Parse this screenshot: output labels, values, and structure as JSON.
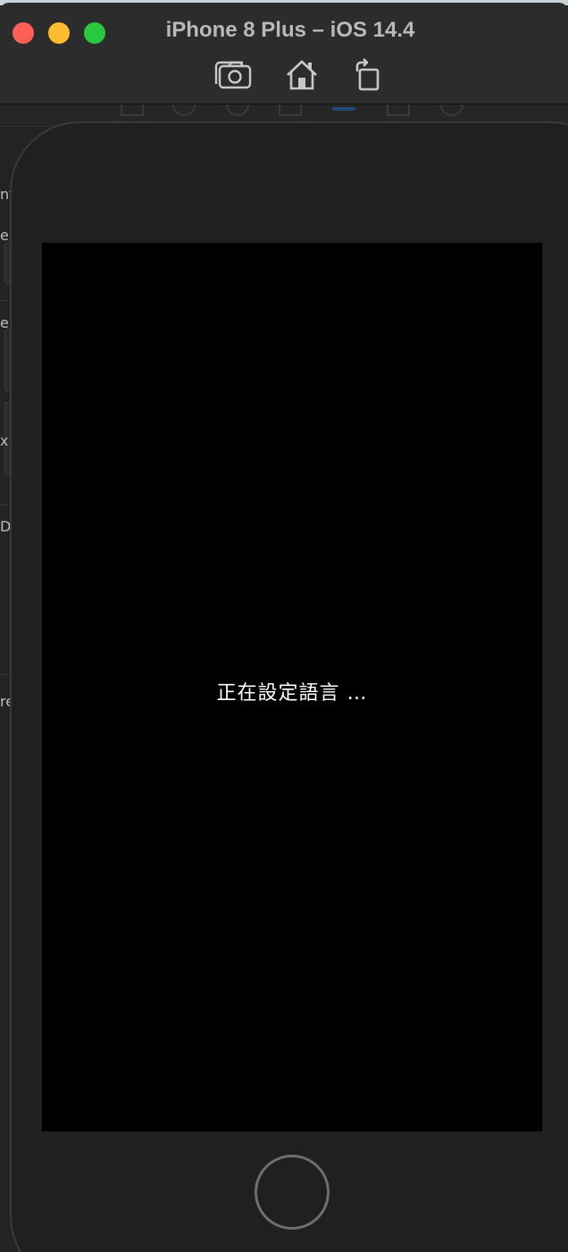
{
  "window": {
    "title": "iPhone 8 Plus – iOS 14.4"
  },
  "toolbar": {
    "icons": [
      "screenshot-icon",
      "home-icon",
      "rotate-icon"
    ]
  },
  "background_panel": {
    "stubs": [
      "nt",
      "e",
      "e",
      "x",
      "D",
      "re"
    ]
  },
  "simulator": {
    "device": "iPhone 8 Plus",
    "screen_message": "正在設定語言 …"
  },
  "colors": {
    "close": "#fe5f57",
    "minimize": "#febc2e",
    "maximize": "#28c840",
    "screen": "#000000",
    "frame": "#202020"
  }
}
